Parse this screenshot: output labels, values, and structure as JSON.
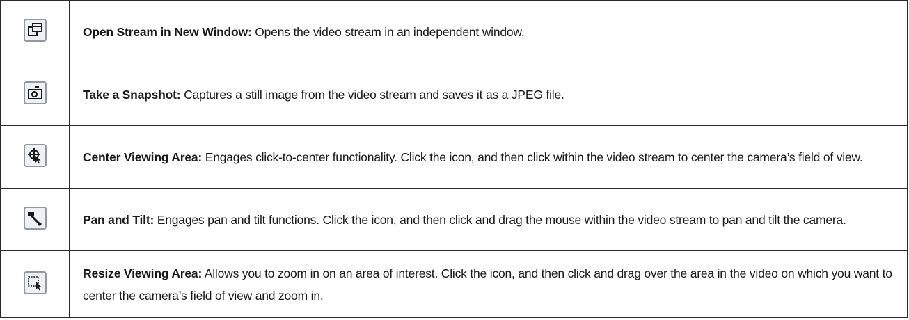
{
  "rows": [
    {
      "icon": "open-new-window-icon",
      "term": "Open Stream in New Window:",
      "description": " Opens the video stream in an independent window."
    },
    {
      "icon": "camera-snapshot-icon",
      "term": "Take a Snapshot:",
      "description": " Captures a still image from the video stream and saves it as a JPEG file."
    },
    {
      "icon": "crosshair-cursor-icon",
      "term": "Center Viewing Area:",
      "description": " Engages click-to-center functionality. Click the icon, and then click within the video stream to center the camera’s field of view."
    },
    {
      "icon": "pan-tilt-icon",
      "term": "Pan and Tilt:",
      "description": " Engages pan and tilt functions. Click the icon, and then click and drag the mouse within the video stream to pan and tilt the camera."
    },
    {
      "icon": "selection-cursor-icon",
      "term": "Resize Viewing Area:",
      "description": " Allows you to zoom in on an area of interest. Click the icon, and then click and drag over the area in the video on which you want to center the camera’s field of view and zoom in."
    }
  ],
  "colors": {
    "icon_border": "#8e99a4",
    "icon_background": "#eef1f3",
    "icon_glyph": "#1a1a1a",
    "table_border": "#2b2b2b"
  }
}
